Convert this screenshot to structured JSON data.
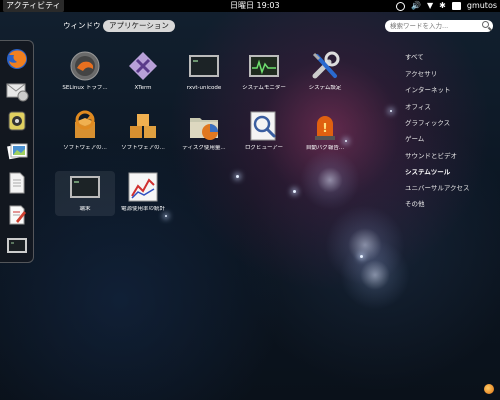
{
  "topbar": {
    "activities": "アクティビティ",
    "clock": "日曜日 19:03",
    "username": "gmutos",
    "tray_icons": [
      "accessibility-icon",
      "volume-icon",
      "network-icon",
      "bluetooth-icon",
      "user-status-icon"
    ]
  },
  "tabs": {
    "windows": "ウィンドウ",
    "applications": "アプリケーション"
  },
  "search": {
    "placeholder": "検索ワードを入力..."
  },
  "dash": {
    "items": [
      "firefox-icon",
      "mail-icon",
      "disk-icon",
      "photos-icon",
      "document-icon",
      "text-editor-icon",
      "terminal-icon"
    ]
  },
  "apps": [
    {
      "label": "SELinux トラブ..."
    },
    {
      "label": "XTerm"
    },
    {
      "label": "rxvt-unicode"
    },
    {
      "label": "システムモニター"
    },
    {
      "label": "システム設定"
    },
    {
      "label": "ソフトウェアの..."
    },
    {
      "label": "ソフトウェアの..."
    },
    {
      "label": "ディスク使用量..."
    },
    {
      "label": "ログビューアー"
    },
    {
      "label": "自動バグ報告..."
    },
    {
      "label": "端末"
    },
    {
      "label": "電源使用率の統計"
    }
  ],
  "categories": [
    "すべて",
    "アクセサリ",
    "インターネット",
    "オフィス",
    "グラフィックス",
    "ゲーム",
    "サウンドとビデオ",
    "システムツール",
    "ユニバーサルアクセス",
    "その他"
  ],
  "active_category": "システムツール",
  "colors": {
    "accent": "#e07010",
    "panel": "#000000"
  }
}
